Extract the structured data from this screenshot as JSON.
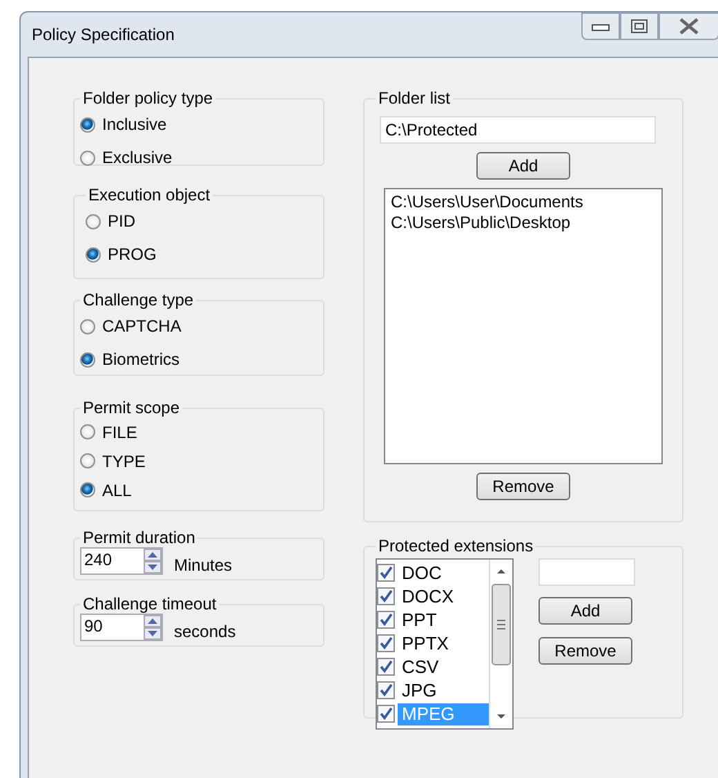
{
  "window": {
    "title": "Policy Specification"
  },
  "left_groups": [
    {
      "kind": "radio",
      "title": "Folder policy type",
      "options": [
        {
          "label": "Inclusive",
          "selected": true
        },
        {
          "label": "Exclusive",
          "selected": false
        }
      ]
    },
    {
      "kind": "radio",
      "title": "Execution object",
      "options": [
        {
          "label": "PID",
          "selected": false
        },
        {
          "label": "PROG",
          "selected": true
        }
      ]
    },
    {
      "kind": "radio",
      "title": "Challenge type",
      "options": [
        {
          "label": "CAPTCHA",
          "selected": false
        },
        {
          "label": "Biometrics",
          "selected": true
        }
      ]
    },
    {
      "kind": "radio",
      "title": "Permit scope",
      "options": [
        {
          "label": "FILE",
          "selected": false
        },
        {
          "label": "TYPE",
          "selected": false
        },
        {
          "label": "ALL",
          "selected": true
        }
      ]
    },
    {
      "kind": "spinner",
      "title": "Permit duration",
      "value": "240",
      "unit": "Minutes"
    },
    {
      "kind": "spinner",
      "title": "Challenge timeout",
      "value": "90",
      "unit": "seconds"
    }
  ],
  "folder_list": {
    "title": "Folder list",
    "path_value": "C:\\Protected",
    "add_button": "Add",
    "items": [
      "C:\\Users\\User\\Documents",
      "C:\\Users\\Public\\Desktop"
    ],
    "remove_button": "Remove"
  },
  "protected_extensions": {
    "title": "Protected extensions",
    "items": [
      {
        "label": "DOC",
        "checked": true,
        "selected": false
      },
      {
        "label": "DOCX",
        "checked": true,
        "selected": false
      },
      {
        "label": "PPT",
        "checked": true,
        "selected": false
      },
      {
        "label": "PPTX",
        "checked": true,
        "selected": false
      },
      {
        "label": "CSV",
        "checked": true,
        "selected": false
      },
      {
        "label": "JPG",
        "checked": true,
        "selected": false
      },
      {
        "label": "MPEG",
        "checked": true,
        "selected": true
      }
    ],
    "add_button": "Add",
    "remove_button": "Remove"
  }
}
